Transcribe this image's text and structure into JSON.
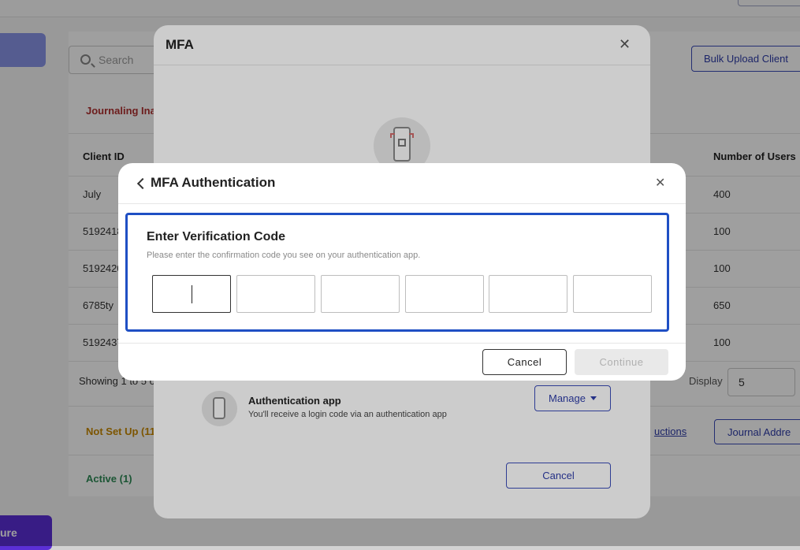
{
  "background": {
    "search_placeholder": "Search",
    "bulk_upload_label": "Bulk Upload Client",
    "section_journaling": "Journaling Ina",
    "col_client_id": "Client ID",
    "col_number_of_users": "Number of Users",
    "rows": [
      {
        "client_id": "July",
        "users": "400"
      },
      {
        "client_id": "5192418",
        "users": "100"
      },
      {
        "client_id": "5192420",
        "users": "100"
      },
      {
        "client_id": "6785ty",
        "users": "650"
      },
      {
        "client_id": "5192437",
        "users": "100"
      }
    ],
    "showing_text": "Showing 1 to 5 of",
    "display_label": "Display",
    "display_value": "5",
    "section_not_set_up": "Not Set Up (11",
    "instructions_link": "uctions",
    "journal_address_label": "Journal Addre",
    "section_active": "Active (1)",
    "bottom_button_label": "ure"
  },
  "mfa_modal": {
    "title": "MFA",
    "auth_app_title": "Authentication app",
    "auth_app_desc": "You'll receive a login code via an authentication app",
    "manage_label": "Manage",
    "cancel_label": "Cancel"
  },
  "auth_dialog": {
    "title": "MFA Authentication",
    "heading": "Enter Verification Code",
    "help_text": "Please enter the confirmation code you see on your authentication app.",
    "code_digits": [
      "",
      "",
      "",
      "",
      "",
      ""
    ],
    "cancel_label": "Cancel",
    "continue_label": "Continue"
  },
  "colors": {
    "accent_blue": "#1f4fc4",
    "link_blue": "#2d3ca8",
    "journaling_red": "#b03030",
    "not_set_up_amber": "#c98a00",
    "active_green": "#2e8b57",
    "purple_button": "#5b2fd6"
  }
}
